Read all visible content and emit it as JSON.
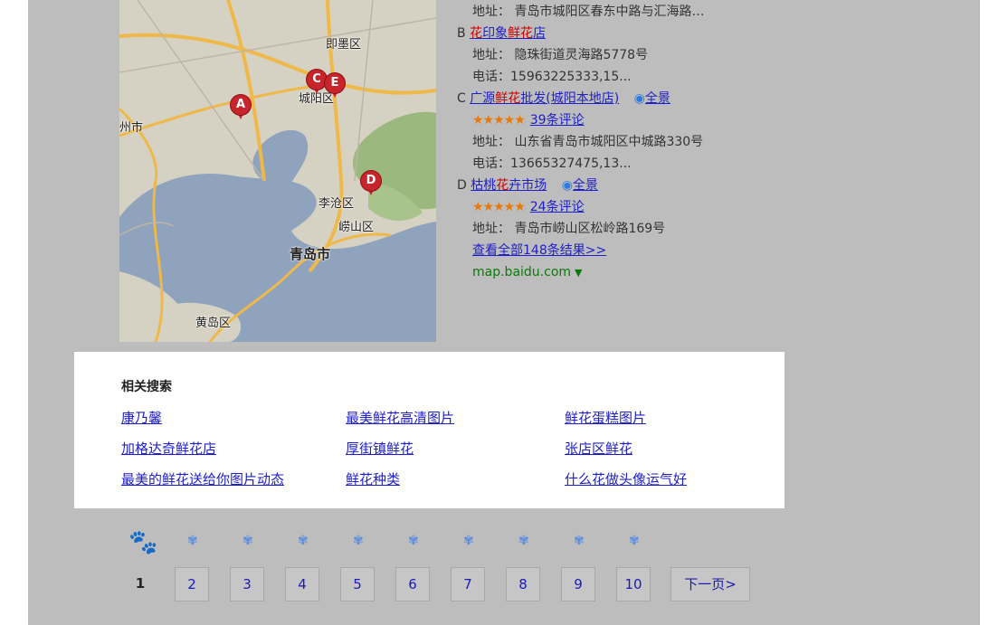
{
  "map": {
    "labels": {
      "jimo": "即墨区",
      "chengyang": "城阳区",
      "jiaozhou": "州市",
      "licang": "李沧区",
      "laoshan": "崂山区",
      "qingdao": "青岛市",
      "huangdao": "黄岛区"
    },
    "pins": [
      "A",
      "C",
      "E",
      "D"
    ]
  },
  "results": {
    "line0": "地址：  青岛市城阳区春东中路与汇海路…",
    "b": {
      "marker": "B",
      "name_parts": [
        "花",
        "印象",
        "鲜花",
        "店"
      ],
      "address": "地址：  隐珠街道灵海路5778号",
      "phone": "电话：15963225333,15..."
    },
    "c": {
      "marker": "C",
      "name_parts": [
        "广源",
        "鲜花",
        "批发(城阳本地店)"
      ],
      "pano": "全景",
      "stars": "★★★★★",
      "reviews": "39条评论",
      "address": "地址：  山东省青岛市城阳区中城路330号",
      "phone": "电话：13665327475,13..."
    },
    "d": {
      "marker": "D",
      "name_parts": [
        "枯桃",
        "花",
        "卉市场"
      ],
      "pano": "全景",
      "stars": "★★★★★",
      "reviews": "24条评论",
      "address": "地址：  青岛市崂山区松岭路169号"
    },
    "view_all": "查看全部148条结果>>",
    "source": "map.baidu.com",
    "source_caret": "▼"
  },
  "related": {
    "title": "相关搜索",
    "items": [
      [
        "康乃馨",
        "最美鲜花高清图片",
        "鲜花蛋糕图片"
      ],
      [
        "加格达奇鲜花店",
        "厚街镇鲜花",
        "张店区鲜花"
      ],
      [
        "最美的鲜花送给你图片动态",
        "鲜花种类",
        "什么花做头像运气好"
      ]
    ]
  },
  "pagination": {
    "pages": [
      "1",
      "2",
      "3",
      "4",
      "5",
      "6",
      "7",
      "8",
      "9",
      "10"
    ],
    "current": "1",
    "next": "下一页>"
  },
  "colors": {
    "link": "#2020c8",
    "highlight": "#cc0000",
    "stars": "#e8780c",
    "source": "#0a7a0a",
    "overlay": "#bdbdbd"
  }
}
